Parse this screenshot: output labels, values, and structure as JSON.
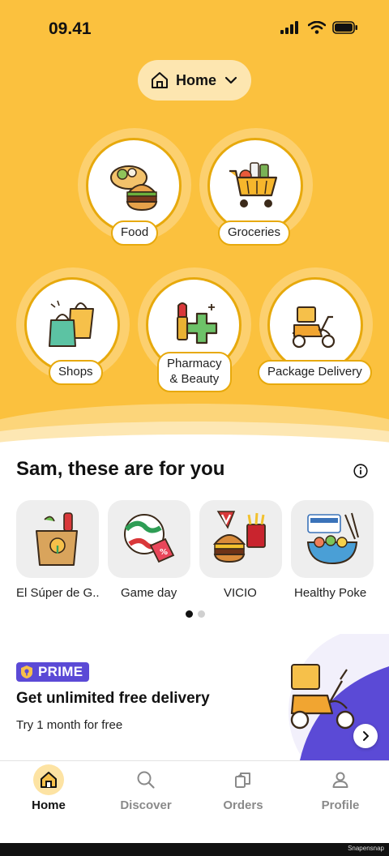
{
  "status": {
    "time": "09.41"
  },
  "location": {
    "label": "Home"
  },
  "categories": [
    {
      "label": "Food"
    },
    {
      "label": "Groceries"
    },
    {
      "label": "Shops"
    },
    {
      "label": "Pharmacy\n& Beauty"
    },
    {
      "label": "Package Delivery"
    }
  ],
  "recommend": {
    "title": "Sam, these are for you",
    "shops": [
      {
        "name": "El Súper de G..."
      },
      {
        "name": "Game day"
      },
      {
        "name": "VICIO"
      },
      {
        "name": "Healthy Poke"
      }
    ],
    "pager": {
      "current": 1,
      "total": 2
    }
  },
  "prime": {
    "badge": "PRIME",
    "title": "Get unlimited free delivery",
    "subtitle": "Try 1 month for free"
  },
  "tabs": [
    {
      "label": "Home",
      "icon": "home-icon",
      "active": true
    },
    {
      "label": "Discover",
      "icon": "search-icon",
      "active": false
    },
    {
      "label": "Orders",
      "icon": "orders-icon",
      "active": false
    },
    {
      "label": "Profile",
      "icon": "profile-icon",
      "active": false
    }
  ],
  "footer": {
    "watermark": "Snapensnap"
  },
  "colors": {
    "brand_yellow": "#fbc13e",
    "prime_purple": "#5b4ad6"
  }
}
